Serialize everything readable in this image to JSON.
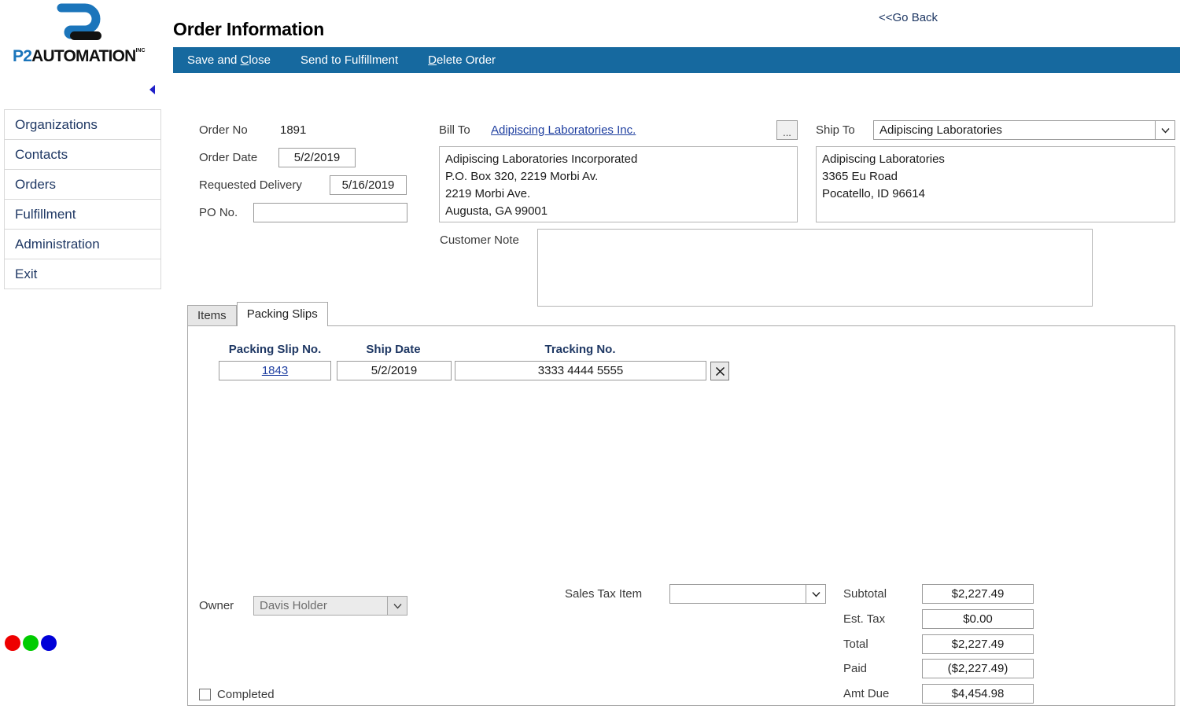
{
  "brand": {
    "logo_p2": "P2",
    "logo_automation": "AUTOMATION",
    "logo_inc": "INC",
    "logo_icon": "p2-logo-mark"
  },
  "sidebar": {
    "items": [
      {
        "label": "Organizations",
        "name": "organizations"
      },
      {
        "label": "Contacts",
        "name": "contacts"
      },
      {
        "label": "Orders",
        "name": "orders"
      },
      {
        "label": "Fulfillment",
        "name": "fulfillment"
      },
      {
        "label": "Administration",
        "name": "administration"
      },
      {
        "label": "Exit",
        "name": "exit"
      }
    ],
    "collapse_icon": "caret-left-icon",
    "status_dots": [
      {
        "name": "status-dot-red",
        "color": "#ee0000"
      },
      {
        "name": "status-dot-green",
        "color": "#00cc00"
      },
      {
        "name": "status-dot-blue",
        "color": "#0000d8"
      }
    ]
  },
  "header": {
    "title": "Order Information",
    "go_back": "<<Go Back"
  },
  "toolbar": {
    "accent_color": "#16699f",
    "save_and_close": {
      "pre": "Save and ",
      "accel": "C",
      "post": "lose"
    },
    "send_to_fulfillment": {
      "pre": "",
      "accel": "",
      "post": "Send to Fulfillment"
    },
    "delete_order": {
      "pre": "",
      "accel": "D",
      "post": "elete Order"
    }
  },
  "order": {
    "order_no_label": "Order No",
    "order_no_value": "1891",
    "order_date_label": "Order Date",
    "order_date_value": "5/2/2019",
    "requested_delivery_label": "Requested Delivery",
    "requested_delivery_value": "5/16/2019",
    "po_no_label": "PO No.",
    "po_no_value": "",
    "po_no_placeholder": ""
  },
  "bill_to": {
    "label": "Bill To",
    "link": "Adipiscing Laboratories Inc.",
    "ellipsis_button": "...",
    "address": "Adipiscing Laboratories Incorporated\nP.O. Box 320, 2219 Morbi Av.\n2219 Morbi Ave.\nAugusta, GA 99001"
  },
  "ship_to": {
    "label": "Ship To",
    "selected": "Adipiscing Laboratories",
    "dropdown_icon": "chevron-down-icon",
    "address": "Adipiscing Laboratories\n3365 Eu Road\nPocatello, ID 96614"
  },
  "customer_note": {
    "label": "Customer Note",
    "value": "",
    "placeholder": ""
  },
  "tabs": [
    {
      "label": "Items",
      "name": "items",
      "active": false
    },
    {
      "label": "Packing Slips",
      "name": "packing-slips",
      "active": true
    }
  ],
  "packing_slips": {
    "columns": [
      "Packing Slip No.",
      "Ship Date",
      "Tracking No."
    ],
    "rows": [
      {
        "packing_slip_no": "1843",
        "ship_date": "5/2/2019",
        "tracking_no": "3333 4444 5555",
        "delete_icon": "close-x-icon"
      }
    ]
  },
  "footer": {
    "owner_label": "Owner",
    "owner_value": "Davis Holder",
    "owner_dropdown_icon": "chevron-down-icon",
    "completed_label": "Completed",
    "completed_checked": false,
    "sales_tax_label": "Sales Tax Item",
    "sales_tax_value": "",
    "sales_tax_dropdown_icon": "chevron-down-icon"
  },
  "totals": [
    {
      "label": "Subtotal",
      "value": "$2,227.49"
    },
    {
      "label": "Est. Tax",
      "value": "$0.00"
    },
    {
      "label": "Total",
      "value": "$2,227.49"
    },
    {
      "label": "Paid",
      "value": "($2,227.49)"
    },
    {
      "label": "Amt Due",
      "value": "$4,454.98"
    }
  ]
}
